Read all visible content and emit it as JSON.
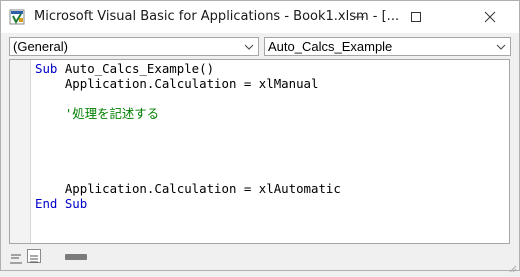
{
  "window": {
    "title": "Microsoft Visual Basic for Applications - Book1.xlsm - [..."
  },
  "toolbar": {
    "object_combo": "(General)",
    "procedure_combo": "Auto_Calcs_Example"
  },
  "code": {
    "lines": [
      [
        {
          "t": "Sub",
          "c": "kw"
        },
        {
          "t": " Auto_Calcs_Example()",
          "c": "tx"
        }
      ],
      [
        {
          "t": "    Application.Calculation = xlManual",
          "c": "tx"
        }
      ],
      [
        {
          "t": "",
          "c": "tx"
        }
      ],
      [
        {
          "t": "    '処理を記述する",
          "c": "cm"
        }
      ],
      [
        {
          "t": "",
          "c": "tx"
        }
      ],
      [
        {
          "t": "",
          "c": "tx"
        }
      ],
      [
        {
          "t": "",
          "c": "tx"
        }
      ],
      [
        {
          "t": "",
          "c": "tx"
        }
      ],
      [
        {
          "t": "    Application.Calculation = xlAutomatic",
          "c": "tx"
        }
      ],
      [
        {
          "t": "End Sub",
          "c": "kw"
        }
      ]
    ]
  },
  "icons": {
    "app": "vba-app-icon",
    "minimize": "minimize-icon",
    "maximize": "maximize-icon",
    "close": "close-icon",
    "combo_arrow": "chevron-down-icon",
    "procedure_view": "procedure-view-icon",
    "full_module_view": "full-module-view-icon"
  },
  "colors": {
    "keyword": "#0000cc",
    "comment": "#008000",
    "text": "#000000"
  }
}
